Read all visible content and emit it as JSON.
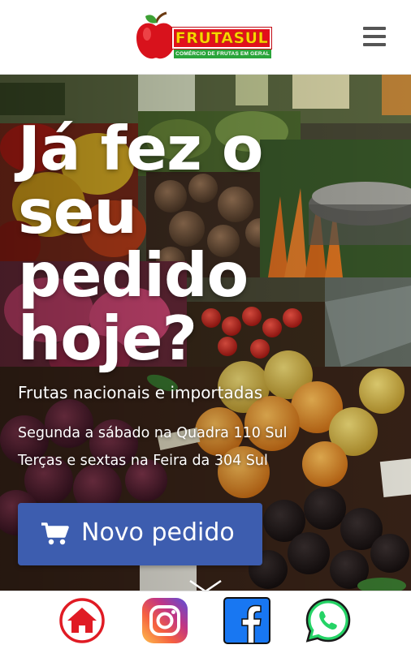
{
  "header": {
    "brand_name": "FRUTASUL",
    "brand_tagline": "COMÉRCIO DE FRUTAS EM GERAL",
    "menu_icon": "hamburger-menu-icon"
  },
  "hero": {
    "headline_lines": [
      "Já fez o",
      "seu",
      "pedido",
      "hoje?"
    ],
    "subtitle": "Frutas nacionais e importadas",
    "schedule_1": "Segunda a sábado na Quadra 110 Sul",
    "schedule_2": "Terças e sextas na Feira da 304 Sul",
    "order_button_label": "Novo pedido",
    "order_button_icon": "shopping-cart-icon",
    "scroll_icon": "chevron-down-icon"
  },
  "footer": {
    "icons": [
      "home-icon",
      "instagram-icon",
      "facebook-icon",
      "whatsapp-icon"
    ]
  },
  "colors": {
    "brand_red": "#e3101c",
    "brand_yellow": "#ffd500",
    "brand_green": "#2aa43a",
    "button_blue": "#3d5daf",
    "home_red": "#e01b24",
    "facebook_blue": "#1877f2",
    "whatsapp_green": "#25d366"
  }
}
